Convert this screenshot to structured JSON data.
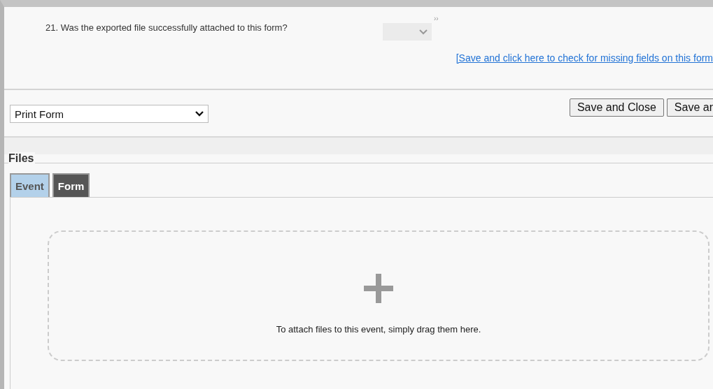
{
  "question": {
    "label": "21. Was the exported file successfully attached to this form?",
    "more": "››"
  },
  "missing_fields_link": "[Save and click here to check for missing fields on this form",
  "print_select": {
    "value": "Print Form"
  },
  "buttons": [
    "Save and Close",
    "Save ar"
  ],
  "files": {
    "title": "Files",
    "tabs": [
      {
        "label": "Event",
        "selected": true
      },
      {
        "label": "Form",
        "selected": false
      }
    ],
    "drop_hint": "To attach files to this event, simply drag them here."
  }
}
